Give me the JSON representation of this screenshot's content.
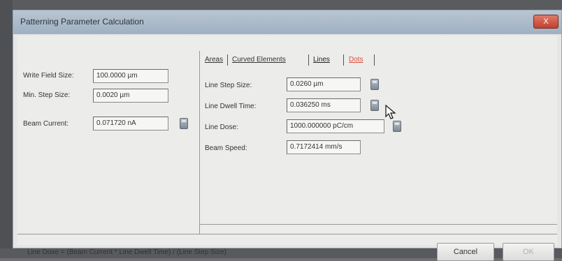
{
  "window": {
    "title": "Patterning Parameter Calculation",
    "close_label": "X"
  },
  "left_panel": {
    "write_field_label": "Write Field Size:",
    "write_field_value": "100.0000 µm",
    "min_step_label": "Min. Step Size:",
    "min_step_value": "0.0020 µm",
    "beam_current_label": "Beam Current:",
    "beam_current_value": "0.071720 nA"
  },
  "tabs": [
    {
      "label": "Areas"
    },
    {
      "label": "Curved Elements"
    },
    {
      "label": "Lines"
    },
    {
      "label": "Dots"
    }
  ],
  "lines_panel": {
    "step_label": "Line Step Size:",
    "step_value": "0.0260 µm",
    "dwell_label": "Line Dwell Time:",
    "dwell_value": "0.036250 ms",
    "dose_label": "Line Dose:",
    "dose_value": "1000.000000 pC/cm",
    "speed_label": "Beam Speed:",
    "speed_value": "0.7172414 mm/s"
  },
  "footer": {
    "formula": "Line Dose = (Beam Current * Line Dwell Time) / (Line Step Size)",
    "cancel_label": "Cancel",
    "ok_label": "OK"
  }
}
